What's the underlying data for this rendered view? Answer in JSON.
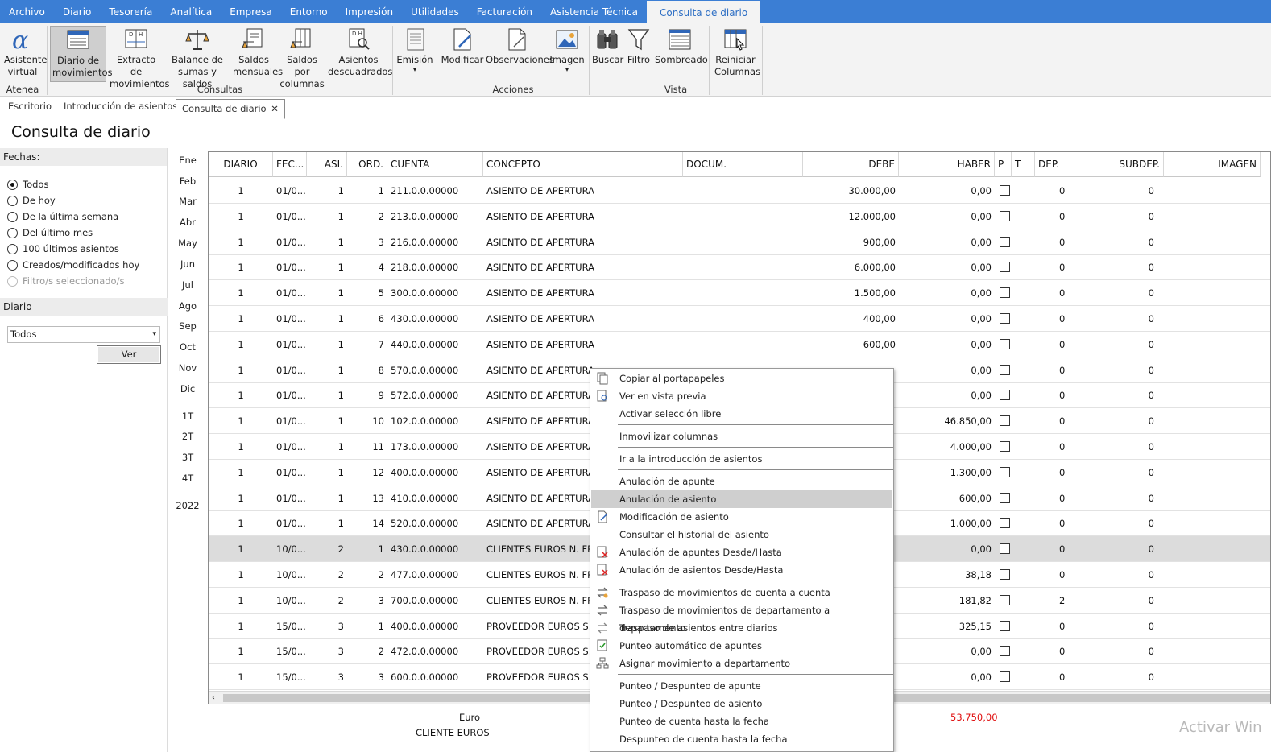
{
  "menubar": [
    "Archivo",
    "Diario",
    "Tesorería",
    "Analítica",
    "Empresa",
    "Entorno",
    "Impresión",
    "Utilidades",
    "Facturación",
    "Asistencia Técnica",
    "Consulta de diario"
  ],
  "ribbon": {
    "asistente": "Asistente virtual",
    "diario_mov": "Diario de movimientos",
    "extracto": "Extracto de movimientos",
    "balance": "Balance de sumas y saldos",
    "saldos_mens": "Saldos mensuales",
    "saldos_col": "Saldos por columnas",
    "descuadrados": "Asientos descuadrados",
    "emision": "Emisión",
    "modificar": "Modificar",
    "observaciones": "Observaciones",
    "imagen": "Imagen",
    "buscar": "Buscar",
    "filtro": "Filtro",
    "sombreado": "Sombreado",
    "reiniciar": "Reiniciar Columnas",
    "groups": {
      "atenea": "Atenea",
      "consultas": "Consultas",
      "acciones": "Acciones",
      "vista": "Vista"
    }
  },
  "tabs": [
    "Escritorio",
    "Introducción de asientos",
    "Consulta de diario"
  ],
  "page_title": "Consulta de diario",
  "left": {
    "fechas_header": "Fechas:",
    "options": [
      "Todos",
      "De hoy",
      "De la última semana",
      "Del último mes",
      "100 últimos asientos",
      "Creados/modificados hoy",
      "Filtro/s seleccionado/s"
    ],
    "diario_header": "Diario",
    "diario_value": "Todos",
    "ver_button": "Ver"
  },
  "months": [
    "Ene",
    "Feb",
    "Mar",
    "Abr",
    "May",
    "Jun",
    "Jul",
    "Ago",
    "Sep",
    "Oct",
    "Nov",
    "Dic"
  ],
  "quarters": [
    "1T",
    "2T",
    "3T",
    "4T"
  ],
  "year": "2022",
  "columns": [
    "DIARIO",
    "FEC...",
    "ASI.",
    "ORD.",
    "CUENTA",
    "CONCEPTO",
    "DOCUM.",
    "DEBE",
    "HABER",
    "P",
    "T",
    "DEP.",
    "SUBDEP.",
    "IMAGEN"
  ],
  "rows": [
    {
      "diario": "1",
      "fec": "01/0...",
      "asi": "1",
      "ord": "1",
      "cuenta": "211.0.0.00000",
      "concepto": "ASIENTO DE APERTURA",
      "debe": "30.000,00",
      "haber": "0,00",
      "dep": "0",
      "subdep": "0"
    },
    {
      "diario": "1",
      "fec": "01/0...",
      "asi": "1",
      "ord": "2",
      "cuenta": "213.0.0.00000",
      "concepto": "ASIENTO DE APERTURA",
      "debe": "12.000,00",
      "haber": "0,00",
      "dep": "0",
      "subdep": "0"
    },
    {
      "diario": "1",
      "fec": "01/0...",
      "asi": "1",
      "ord": "3",
      "cuenta": "216.0.0.00000",
      "concepto": "ASIENTO DE APERTURA",
      "debe": "900,00",
      "haber": "0,00",
      "dep": "0",
      "subdep": "0"
    },
    {
      "diario": "1",
      "fec": "01/0...",
      "asi": "1",
      "ord": "4",
      "cuenta": "218.0.0.00000",
      "concepto": "ASIENTO DE APERTURA",
      "debe": "6.000,00",
      "haber": "0,00",
      "dep": "0",
      "subdep": "0"
    },
    {
      "diario": "1",
      "fec": "01/0...",
      "asi": "1",
      "ord": "5",
      "cuenta": "300.0.0.00000",
      "concepto": "ASIENTO DE APERTURA",
      "debe": "1.500,00",
      "haber": "0,00",
      "dep": "0",
      "subdep": "0"
    },
    {
      "diario": "1",
      "fec": "01/0...",
      "asi": "1",
      "ord": "6",
      "cuenta": "430.0.0.00000",
      "concepto": "ASIENTO DE APERTURA",
      "debe": "400,00",
      "haber": "0,00",
      "dep": "0",
      "subdep": "0"
    },
    {
      "diario": "1",
      "fec": "01/0...",
      "asi": "1",
      "ord": "7",
      "cuenta": "440.0.0.00000",
      "concepto": "ASIENTO DE APERTURA",
      "debe": "600,00",
      "haber": "0,00",
      "dep": "0",
      "subdep": "0"
    },
    {
      "diario": "1",
      "fec": "01/0...",
      "asi": "1",
      "ord": "8",
      "cuenta": "570.0.0.00000",
      "concepto": "ASIENTO DE APERTURA",
      "debe": "",
      "haber": "0,00",
      "dep": "0",
      "subdep": "0"
    },
    {
      "diario": "1",
      "fec": "01/0...",
      "asi": "1",
      "ord": "9",
      "cuenta": "572.0.0.00000",
      "concepto": "ASIENTO DE APERTURA",
      "debe": "",
      "haber": "0,00",
      "dep": "0",
      "subdep": "0"
    },
    {
      "diario": "1",
      "fec": "01/0...",
      "asi": "1",
      "ord": "10",
      "cuenta": "102.0.0.00000",
      "concepto": "ASIENTO DE APERTURA",
      "debe": "",
      "haber": "46.850,00",
      "dep": "0",
      "subdep": "0"
    },
    {
      "diario": "1",
      "fec": "01/0...",
      "asi": "1",
      "ord": "11",
      "cuenta": "173.0.0.00000",
      "concepto": "ASIENTO DE APERTURA",
      "debe": "",
      "haber": "4.000,00",
      "dep": "0",
      "subdep": "0"
    },
    {
      "diario": "1",
      "fec": "01/0...",
      "asi": "1",
      "ord": "12",
      "cuenta": "400.0.0.00000",
      "concepto": "ASIENTO DE APERTURA",
      "debe": "",
      "haber": "1.300,00",
      "dep": "0",
      "subdep": "0"
    },
    {
      "diario": "1",
      "fec": "01/0...",
      "asi": "1",
      "ord": "13",
      "cuenta": "410.0.0.00000",
      "concepto": "ASIENTO DE APERTURA",
      "debe": "",
      "haber": "600,00",
      "dep": "0",
      "subdep": "0"
    },
    {
      "diario": "1",
      "fec": "01/0...",
      "asi": "1",
      "ord": "14",
      "cuenta": "520.0.0.00000",
      "concepto": "ASIENTO DE APERTURA",
      "debe": "",
      "haber": "1.000,00",
      "dep": "0",
      "subdep": "0"
    },
    {
      "diario": "1",
      "fec": "10/0...",
      "asi": "2",
      "ord": "1",
      "cuenta": "430.0.0.00000",
      "concepto": "CLIENTES EUROS N. FRA",
      "debe": "",
      "haber": "0,00",
      "dep": "0",
      "subdep": "0"
    },
    {
      "diario": "1",
      "fec": "10/0...",
      "asi": "2",
      "ord": "2",
      "cuenta": "477.0.0.00000",
      "concepto": "CLIENTES EUROS N. FRA",
      "debe": "",
      "haber": "38,18",
      "dep": "0",
      "subdep": "0"
    },
    {
      "diario": "1",
      "fec": "10/0...",
      "asi": "2",
      "ord": "3",
      "cuenta": "700.0.0.00000",
      "concepto": "CLIENTES EUROS N. FRA",
      "debe": "",
      "haber": "181,82",
      "dep": "2",
      "subdep": "0"
    },
    {
      "diario": "1",
      "fec": "15/0...",
      "asi": "3",
      "ord": "1",
      "cuenta": "400.0.0.00000",
      "concepto": "PROVEEDOR EUROS S. FR",
      "debe": "",
      "haber": "325,15",
      "dep": "0",
      "subdep": "0"
    },
    {
      "diario": "1",
      "fec": "15/0...",
      "asi": "3",
      "ord": "2",
      "cuenta": "472.0.0.00000",
      "concepto": "PROVEEDOR EUROS S. FR",
      "debe": "",
      "haber": "0,00",
      "dep": "0",
      "subdep": "0"
    },
    {
      "diario": "1",
      "fec": "15/0...",
      "asi": "3",
      "ord": "3",
      "cuenta": "600.0.0.00000",
      "concepto": "PROVEEDOR EUROS S. FR",
      "debe": "",
      "haber": "0,00",
      "dep": "0",
      "subdep": "0"
    }
  ],
  "footer": {
    "euro_label": "Euro",
    "cliente_label": "CLIENTE EUROS",
    "total": "53.750,00",
    "total_color": "#e01010"
  },
  "context_menu": [
    "Copiar al portapapeles",
    "Ver en vista previa",
    "Activar selección libre",
    "Inmovilizar columnas",
    "Ir a la introducción de asientos",
    "Anulación de apunte",
    "Anulación de asiento",
    "Modificación de asiento",
    "Consultar el historial del asiento",
    "Anulación de apuntes Desde/Hasta",
    "Anulación de asientos Desde/Hasta",
    "Traspaso de movimientos de cuenta a cuenta",
    "Traspaso de movimientos de departamento a departamento",
    "Traspaso de asientos entre diarios",
    "Punteo automático de apuntes",
    "Asignar movimiento a departamento",
    "Punteo / Despunteo de apunte",
    "Punteo / Despunteo de asiento",
    "Punteo de cuenta hasta la fecha",
    "Despunteo de cuenta hasta la fecha"
  ],
  "watermark": "Activar Win",
  "colors": {
    "menubar": "#3b7ed4",
    "selected_row": "#dcdcdc",
    "menu_highlight": "#cfcfcf"
  }
}
